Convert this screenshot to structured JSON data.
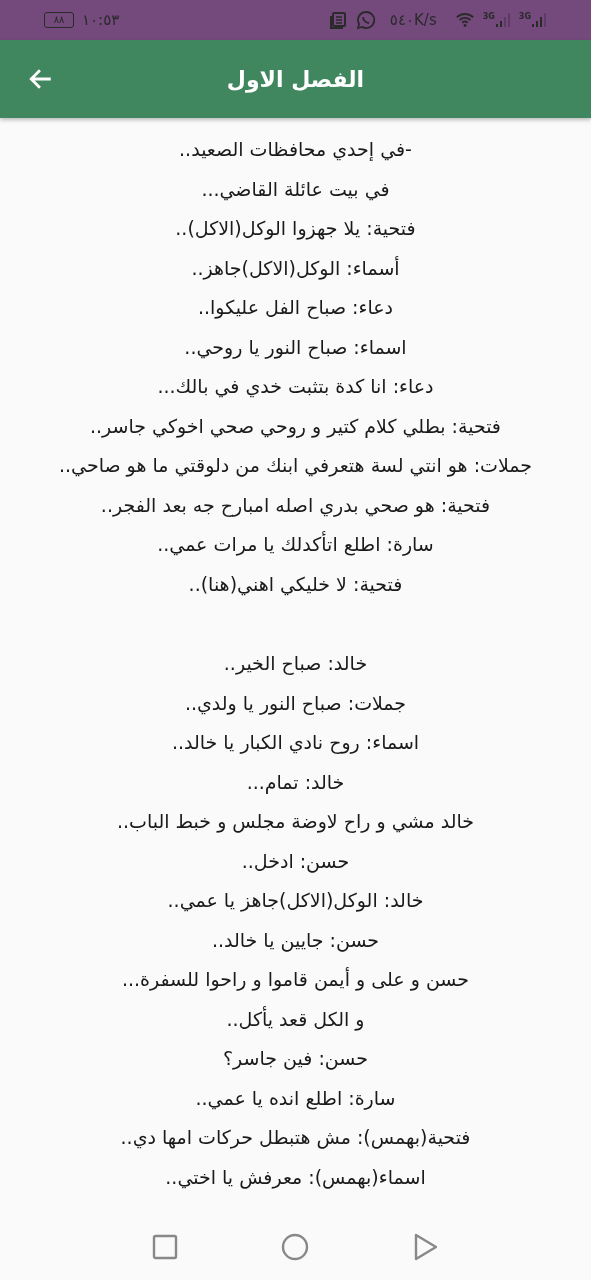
{
  "status_bar": {
    "time": "١٠:٥٣",
    "battery": "٨٨",
    "speed": "٥٤٠K/s",
    "network_1": "3G",
    "network_2": "3G"
  },
  "app_bar": {
    "title": "الفصل الاول"
  },
  "passages": [
    {
      "lines": [
        "-في إحدي محافظات الصعيد..",
        "في بيت عائلة القاضي...",
        "فتحية: يلا جهزوا الوكل(الاكل)..",
        "أسماء: الوكل(الاكل)جاهز..",
        "دعاء: صباح الفل عليكوا..",
        "اسماء: صباح النور يا روحي..",
        "دعاء: انا كدة بتثبت خدي في بالك...",
        "فتحية: بطلي كلام كتير و روحي صحي اخوكي جاسر..",
        "جملات: هو انتي لسة هتعرفي ابنك من دلوقتي ما هو صاحي..",
        "فتحية: هو صحي بدري اصله امبارح جه بعد الفجر..",
        "سارة: اطلع اتأكدلك يا مرات عمي..",
        "فتحية: لا خليكي اهني(هنا).."
      ]
    },
    {
      "lines": [
        "خالد: صباح الخير..",
        "جملات: صباح النور يا ولدي..",
        "اسماء: روح نادي الكبار يا خالد..",
        "خالد: تمام...",
        "خالد مشي و راح لاوضة مجلس و خبط الباب..",
        "حسن: ادخل..",
        "خالد: الوكل(الاكل)جاهز يا عمي..",
        "حسن: جايين يا خالد..",
        "حسن و على و أيمن قاموا و راحوا للسفرة...",
        "و الكل قعد يأكل..",
        "حسن: فين جاسر؟",
        "سارة: اطلع انده يا عمي..",
        "فتحية(بهمس): مش هتبطل حركات امها دي..",
        "اسماء(بهمس): معرفش يا اختي.."
      ]
    }
  ]
}
